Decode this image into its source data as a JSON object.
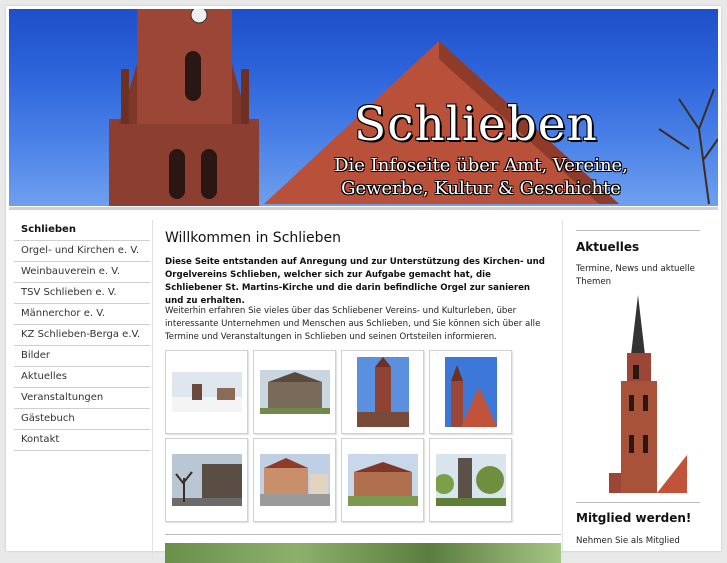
{
  "header": {
    "title": "Schlieben",
    "subtitle_line1": "Die Infoseite über Amt, Vereine,",
    "subtitle_line2": "Gewerbe, Kultur & Geschichte"
  },
  "nav": {
    "items": [
      {
        "label": "Schlieben"
      },
      {
        "label": "Orgel- und Kirchen e. V."
      },
      {
        "label": "Weinbauverein e. V."
      },
      {
        "label": "TSV Schlieben e. V."
      },
      {
        "label": "Männerchor e. V."
      },
      {
        "label": "KZ Schlieben-Berga e.V."
      },
      {
        "label": "Bilder"
      },
      {
        "label": "Aktuelles"
      },
      {
        "label": "Veranstaltungen"
      },
      {
        "label": "Gästebuch"
      },
      {
        "label": "Kontakt"
      }
    ]
  },
  "main": {
    "heading": "Willkommen in Schlieben",
    "intro": "Diese Seite entstanden auf Anregung und zur Unterstützung des Kirchen- und Orgelvereins Schlieben, welcher sich zur Aufgabe gemacht hat, die Schliebener St. Martins-Kirche und die darin befindliche Orgel zur sanieren und zu erhalten.",
    "body": "Weiterhin erfahren Sie vieles über das Schliebener Vereins- und Kulturleben, über interessante Unternehmen und Menschen aus Schlieben, und Sie können sich über alle Termine und Veranstaltungen in Schlieben und seinen Ortsteilen informieren."
  },
  "aside": {
    "news_heading": "Aktuelles",
    "news_text": "Termine, News und aktuelle Themen",
    "member_heading": "Mitglied werden!",
    "member_text": "Nehmen Sie als Mitglied"
  },
  "colors": {
    "sky": "#2f66dc",
    "brick": "#a9523a",
    "roof": "#c0533a"
  }
}
